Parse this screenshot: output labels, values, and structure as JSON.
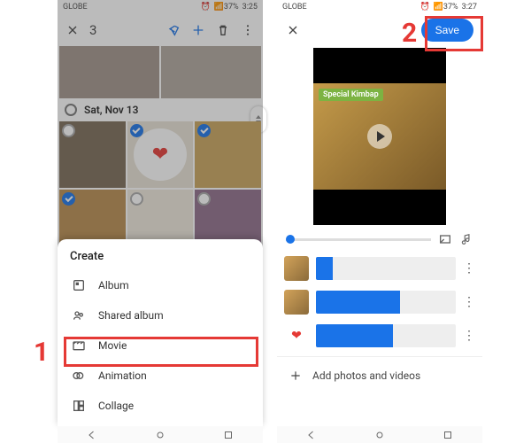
{
  "left": {
    "status": {
      "carrier": "GLOBE",
      "signal": "▾◂▸◆",
      "battery": "37%",
      "time": "3:25",
      "alarm": "⏰"
    },
    "appbar": {
      "selected_count": "3"
    },
    "date_header": "Sat, Nov 13",
    "sheet": {
      "title": "Create",
      "items": [
        {
          "label": "Album"
        },
        {
          "label": "Shared album"
        },
        {
          "label": "Movie"
        },
        {
          "label": "Animation"
        },
        {
          "label": "Collage"
        }
      ]
    }
  },
  "right": {
    "status": {
      "carrier": "GLOBE",
      "signal": "▾◂▸◆",
      "battery": "37%",
      "time": "3:27",
      "alarm": "⏰"
    },
    "save_label": "Save",
    "preview": {
      "title_text": "Special Kimbap"
    },
    "clips": [
      {
        "fill_pct": 12
      },
      {
        "fill_pct": 60
      },
      {
        "fill_pct": 55
      }
    ],
    "add_label": "Add photos and videos"
  },
  "callouts": {
    "one": "1",
    "two": "2"
  }
}
